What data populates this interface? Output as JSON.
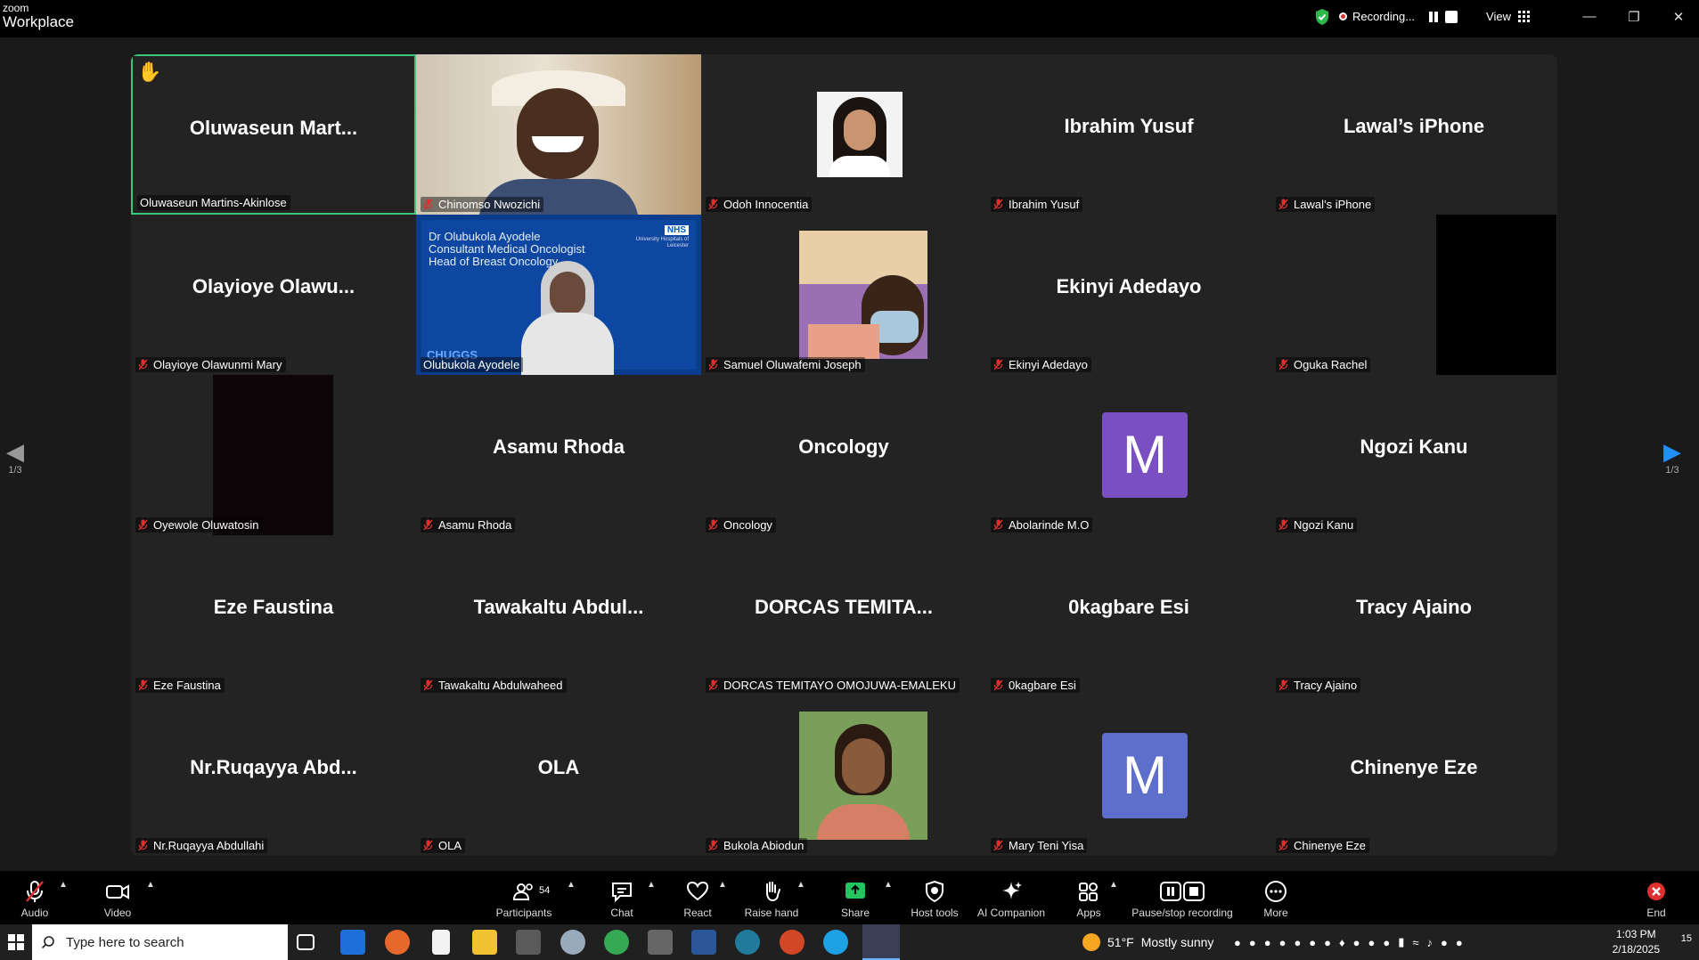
{
  "app": {
    "brand_small": "zoom",
    "brand_big": "Workplace"
  },
  "topbar": {
    "recording_label": "Recording...",
    "view_label": "View",
    "window_controls": [
      "minimize-icon",
      "restore-icon",
      "close-icon"
    ]
  },
  "nav": {
    "left_page": "1/3",
    "right_page": "1/3"
  },
  "tiles": [
    {
      "display": "Oluwaseun Mart...",
      "label": "Oluwaseun Martins-Akinlose",
      "kind": "name",
      "active": true,
      "hand_raised": true,
      "muted": false
    },
    {
      "display": "",
      "label": "Chinomso Nwozichi",
      "kind": "video-man",
      "muted": true
    },
    {
      "display": "",
      "label": "Odoh Innocentia",
      "kind": "photo-woman",
      "muted": true
    },
    {
      "display": "Ibrahim Yusuf",
      "label": "Ibrahim Yusuf",
      "kind": "name",
      "muted": true
    },
    {
      "display": "Lawal’s iPhone",
      "label": "Lawal’s iPhone",
      "kind": "name",
      "muted": true
    },
    {
      "display": "Olayioye Olawu...",
      "label": "Olayioye Olawunmi Mary",
      "kind": "name",
      "muted": true
    },
    {
      "display": "",
      "label": "Olubukola Ayodele",
      "kind": "slide",
      "muted": false,
      "slide_lines": [
        "Dr Olubukola Ayodele",
        "Consultant Medical Oncologist",
        "Head of Breast Oncology"
      ],
      "slide_badge": "NHS",
      "slide_org": "University Hospitals of Leicester",
      "slide_footer": "CHUGGS"
    },
    {
      "display": "",
      "label": "Samuel Oluwafemi Joseph",
      "kind": "video-mask",
      "muted": true
    },
    {
      "display": "Ekinyi Adedayo",
      "label": "Ekinyi Adedayo",
      "kind": "name",
      "muted": true
    },
    {
      "display": "",
      "label": "Oguka Rachel",
      "kind": "dark",
      "muted": true
    },
    {
      "display": "",
      "label": "Oyewole Oluwatosin",
      "kind": "dark-left",
      "muted": true
    },
    {
      "display": "Asamu Rhoda",
      "label": "Asamu Rhoda",
      "kind": "name",
      "muted": true
    },
    {
      "display": "Oncology",
      "label": "Oncology",
      "kind": "name",
      "muted": true
    },
    {
      "display": "M",
      "label": "Abolarinde M.O",
      "kind": "avatar",
      "avatar_color": "#7a4fc2",
      "muted": true
    },
    {
      "display": "Ngozi Kanu",
      "label": "Ngozi Kanu",
      "kind": "name",
      "muted": true
    },
    {
      "display": "Eze Faustina",
      "label": "Eze Faustina",
      "kind": "name",
      "muted": true
    },
    {
      "display": "Tawakaltu  Abdul...",
      "label": "Tawakaltu Abdulwaheed",
      "kind": "name",
      "muted": true
    },
    {
      "display": "DORCAS  TEMITA...",
      "label": "DORCAS TEMITAYO OMOJUWA-EMALEKU",
      "kind": "name",
      "muted": true
    },
    {
      "display": "0kagbare Esi",
      "label": "0kagbare Esi",
      "kind": "name",
      "muted": true
    },
    {
      "display": "Tracy Ajaino",
      "label": "Tracy Ajaino",
      "kind": "name",
      "muted": true
    },
    {
      "display": "Nr.Ruqayya  Abd...",
      "label": "Nr.Ruqayya Abdullahi",
      "kind": "name",
      "muted": true
    },
    {
      "display": "OLA",
      "label": "OLA",
      "kind": "name",
      "muted": true
    },
    {
      "display": "",
      "label": "Bukola Abiodun",
      "kind": "photo-woman2",
      "muted": true
    },
    {
      "display": "M",
      "label": "Mary Teni Yisa",
      "kind": "avatar",
      "avatar_color": "#5e6ecb",
      "muted": true
    },
    {
      "display": "Chinenye Eze",
      "label": "Chinenye Eze",
      "kind": "name",
      "muted": true
    }
  ],
  "toolbar": {
    "audio": "Audio",
    "video": "Video",
    "participants": "Participants",
    "participants_count": "54",
    "chat": "Chat",
    "react": "React",
    "raise_hand": "Raise hand",
    "share": "Share",
    "host_tools": "Host tools",
    "ai_companion": "AI Companion",
    "apps": "Apps",
    "pause_recording": "Pause/stop recording",
    "more": "More",
    "end": "End"
  },
  "taskbar": {
    "search_placeholder": "Type here to search",
    "weather_temp": "51°F",
    "weather_text": "Mostly sunny",
    "time": "1:03 PM",
    "date": "2/18/2025",
    "notifications": "15"
  },
  "colors": {
    "active_border": "#3bc47a",
    "share_green": "#22c55e",
    "end_red": "#e02f2f",
    "nav_blue": "#1e90ff"
  }
}
